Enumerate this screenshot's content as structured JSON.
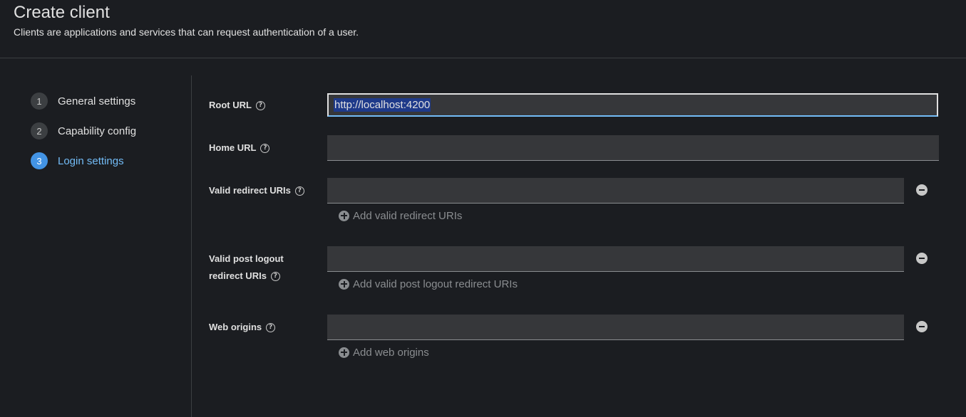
{
  "header": {
    "title": "Create client",
    "subtitle": "Clients are applications and services that can request authentication of a user."
  },
  "wizard": {
    "steps": [
      {
        "number": "1",
        "label": "General settings"
      },
      {
        "number": "2",
        "label": "Capability config"
      },
      {
        "number": "3",
        "label": "Login settings"
      }
    ],
    "active_step": "3"
  },
  "form": {
    "root_url": {
      "label": "Root URL",
      "value": "http://localhost:4200"
    },
    "home_url": {
      "label": "Home URL",
      "value": ""
    },
    "valid_redirect_uris": {
      "label": "Valid redirect URIs",
      "value": "",
      "add_label": "Add valid redirect URIs"
    },
    "valid_post_logout_redirect_uris": {
      "label_line1": "Valid post logout",
      "label_line2": "redirect URIs",
      "value": "",
      "add_label": "Add valid post logout redirect URIs"
    },
    "web_origins": {
      "label": "Web origins",
      "value": "",
      "add_label": "Add web origins"
    }
  },
  "icons": {
    "help": "help-circle-icon",
    "remove": "minus-circle-icon",
    "add": "plus-circle-icon"
  },
  "colors": {
    "background": "#1b1d21",
    "accent": "#4394e5",
    "active_text": "#73bcf7",
    "input_bg": "#36373a"
  }
}
